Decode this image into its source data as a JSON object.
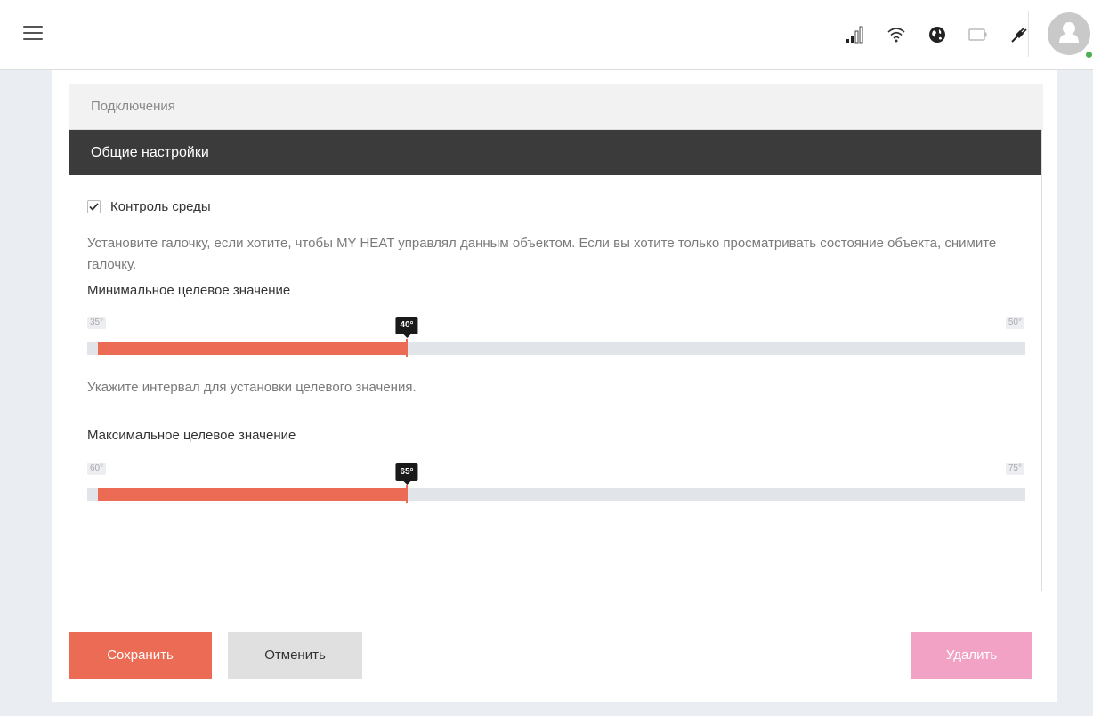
{
  "header": {
    "icons": [
      "menu-icon",
      "signal-icon",
      "wifi-icon",
      "globe-icon",
      "battery-icon",
      "plug-icon",
      "user-avatar-icon"
    ]
  },
  "tabs": {
    "connections": "Подключения",
    "general": "Общие настройки"
  },
  "form": {
    "env_control": {
      "label": "Контроль среды",
      "checked": true
    },
    "env_help": "Установите галочку, если хотите, чтобы MY HEAT управлял данным объектом. Если вы хотите только просматривать состояние объекта, снимите галочку.",
    "min_target": {
      "label": "Минимальное целевое значение",
      "min": "35°",
      "max": "50°",
      "value": "40°",
      "fraction": 0.333
    },
    "interval_help": "Укажите интервал для установки целевого значения.",
    "max_target": {
      "label": "Максимальное целевое значение",
      "min": "60°",
      "max": "75°",
      "value": "65°",
      "fraction": 0.333
    }
  },
  "actions": {
    "save": "Сохранить",
    "cancel": "Отменить",
    "delete": "Удалить"
  },
  "colors": {
    "accent": "#ec6b54",
    "delete": "#f2a2c5",
    "dark_header": "#3b3b3b",
    "online": "#4caf50"
  }
}
